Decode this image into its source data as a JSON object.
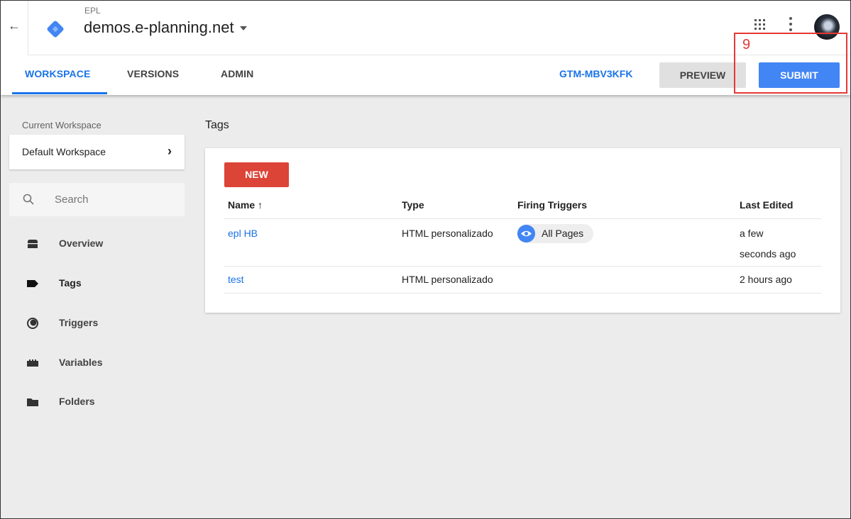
{
  "header": {
    "back_icon": "arrow-left",
    "logo_icon": "gtm-diamond-logo",
    "account": "EPL",
    "container": "demos.e-planning.net",
    "apps_icon": "apps-grid",
    "more_icon": "more-vertical"
  },
  "tabs": [
    {
      "label": "WORKSPACE",
      "active": true
    },
    {
      "label": "VERSIONS",
      "active": false
    },
    {
      "label": "ADMIN",
      "active": false
    }
  ],
  "actions": {
    "container_id": "GTM-MBV3KFK",
    "preview_label": "PREVIEW",
    "submit_label": "SUBMIT"
  },
  "annotation": {
    "number": "9",
    "color": "#e53935"
  },
  "sidebar": {
    "workspace_label": "Current Workspace",
    "workspace_name": "Default Workspace",
    "search_placeholder": "Search",
    "items": [
      {
        "label": "Overview",
        "icon": "overview-icon",
        "active": false
      },
      {
        "label": "Tags",
        "icon": "tag-icon",
        "active": true
      },
      {
        "label": "Triggers",
        "icon": "trigger-icon",
        "active": false
      },
      {
        "label": "Variables",
        "icon": "variables-icon",
        "active": false
      },
      {
        "label": "Folders",
        "icon": "folder-icon",
        "active": false
      }
    ]
  },
  "main": {
    "title": "Tags",
    "new_label": "NEW",
    "columns": [
      "Name ↑",
      "Type",
      "Firing Triggers",
      "Last Edited"
    ],
    "rows": [
      {
        "name": "epl HB",
        "type": "HTML personalizado",
        "trigger": "All Pages",
        "edited_1": "a few",
        "edited_2": "seconds ago"
      },
      {
        "name": "test",
        "type": "HTML personalizado",
        "trigger": "",
        "edited_1": "2 hours ago",
        "edited_2": ""
      }
    ]
  },
  "colors": {
    "accent": "#1a73e8",
    "submit": "#4285f4",
    "new": "#db4437",
    "background": "#ececec"
  }
}
